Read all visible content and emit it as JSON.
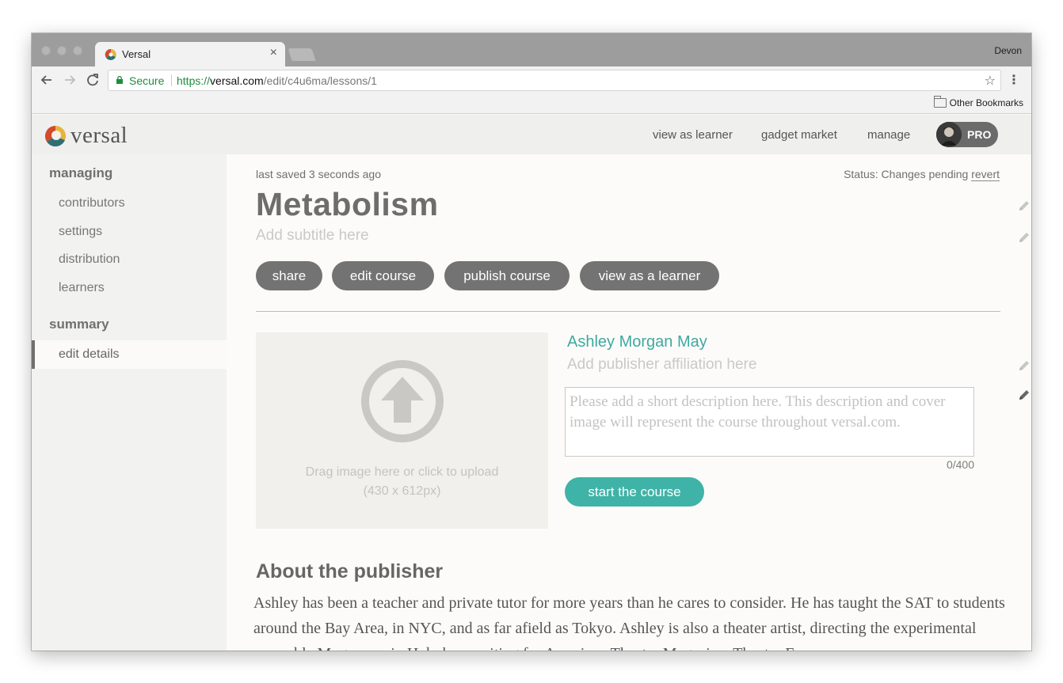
{
  "browser": {
    "tab_title": "Versal",
    "tab_close": "×",
    "profile_name": "Devon",
    "secure_label": "Secure",
    "url_scheme": "https://",
    "url_host": "versal.com",
    "url_path": "/edit/c4u6ma/lessons/1",
    "other_bookmarks": "Other Bookmarks"
  },
  "app": {
    "logo_text": "versal",
    "nav": [
      {
        "label": "view as learner"
      },
      {
        "label": "gadget market"
      },
      {
        "label": "manage"
      }
    ],
    "plan_badge": "PRO"
  },
  "sidebar": {
    "sections": [
      {
        "heading": "managing",
        "items": [
          "contributors",
          "settings",
          "distribution",
          "learners"
        ]
      },
      {
        "heading": "summary",
        "items": [
          "edit details"
        ]
      }
    ],
    "active_item": "edit details"
  },
  "course": {
    "last_saved": "last saved 3 seconds ago",
    "status_text": "Status: Changes pending",
    "revert_label": "revert",
    "title": "Metabolism",
    "subtitle_placeholder": "Add subtitle here",
    "actions": [
      "share",
      "edit course",
      "publish course",
      "view as a learner"
    ],
    "cover_upload": {
      "text": "Drag image here or click to upload",
      "size_hint": "(430 x 612px)"
    },
    "publisher_name": "Ashley Morgan May",
    "affiliation_placeholder": "Add publisher affiliation here",
    "description_placeholder": "Please add a short description here. This description and cover image will represent the course throughout versal.com.",
    "char_counter": "0/400",
    "start_label": "start the course",
    "about_heading": "About the publisher",
    "about_text": "Ashley has been a teacher and private tutor for more years than he cares to consider. He has taught the SAT to students around the Bay Area, in NYC, and as far afield as Tokyo. Ashley is also a theater artist, directing the experimental ensemble Mugwump in Hoboken, writing for American Theatre Magazine, Theatre Forum"
  },
  "colors": {
    "accent_teal": "#3fb3a7",
    "button_gray": "#737373",
    "secure_green": "#1e8e3e"
  },
  "icons": {
    "back": "arrow-left",
    "forward": "arrow-right",
    "reload": "reload",
    "star": "star-outline",
    "menu": "kebab-vertical",
    "edit": "pencil",
    "upload": "circle-arrow-up"
  }
}
